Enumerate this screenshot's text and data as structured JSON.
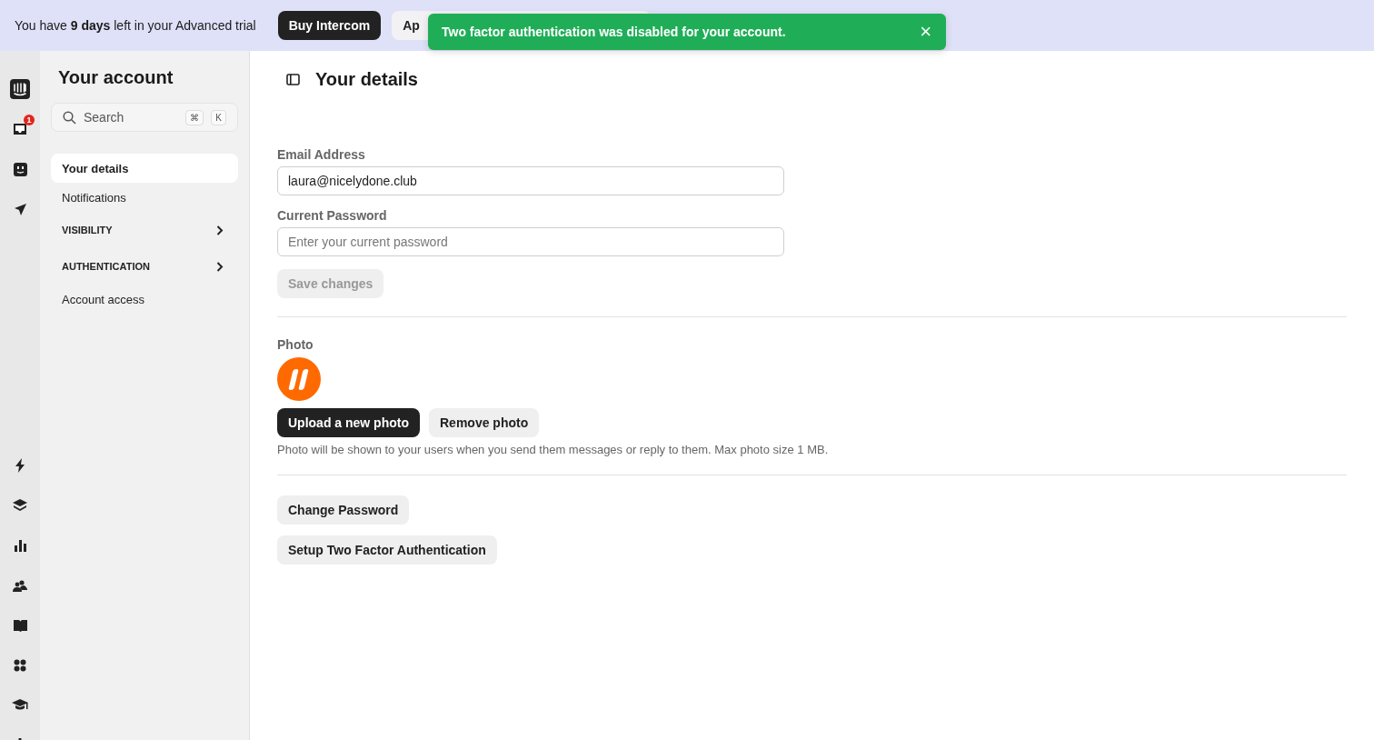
{
  "banner": {
    "text": "You have **9 days** left in your Advanced trial",
    "buttons": [
      {
        "label": "Buy Intercom",
        "kind": "primary"
      },
      {
        "label": "Ap",
        "kind": "secondary"
      }
    ]
  },
  "toast": {
    "message": "Two factor authentication was disabled for your account.",
    "close": "×"
  },
  "rail": {
    "badge": "1"
  },
  "sidebar": {
    "title": "Your account",
    "search": {
      "placeholder": "Search",
      "keys": [
        "⌘",
        "K"
      ]
    },
    "items": [
      {
        "label": "Your details",
        "kind": "item",
        "selected": true
      },
      {
        "label": "Notifications",
        "kind": "item",
        "selected": false
      },
      {
        "label": "VISIBILITY",
        "kind": "section",
        "selected": false
      },
      {
        "label": "AUTHENTICATION",
        "kind": "section",
        "selected": false
      },
      {
        "label": "Account access",
        "kind": "item",
        "selected": false
      }
    ]
  },
  "main": {
    "title": "Your details",
    "fields": [
      {
        "label": "Email Address",
        "value": "laura@nicelydone.club"
      },
      {
        "label": "Current Password",
        "placeholder": "Enter your current password"
      }
    ],
    "save": {
      "label": "Save changes",
      "disabled": true
    },
    "photo": {
      "label": "Photo",
      "upload": "Upload a new photo",
      "remove": "Remove photo",
      "hint": "Photo will be shown to your users when you send them messages or reply to them. Max photo size 1 MB."
    },
    "actions": [
      "Change Password",
      "Setup Two Factor Authentication"
    ]
  }
}
